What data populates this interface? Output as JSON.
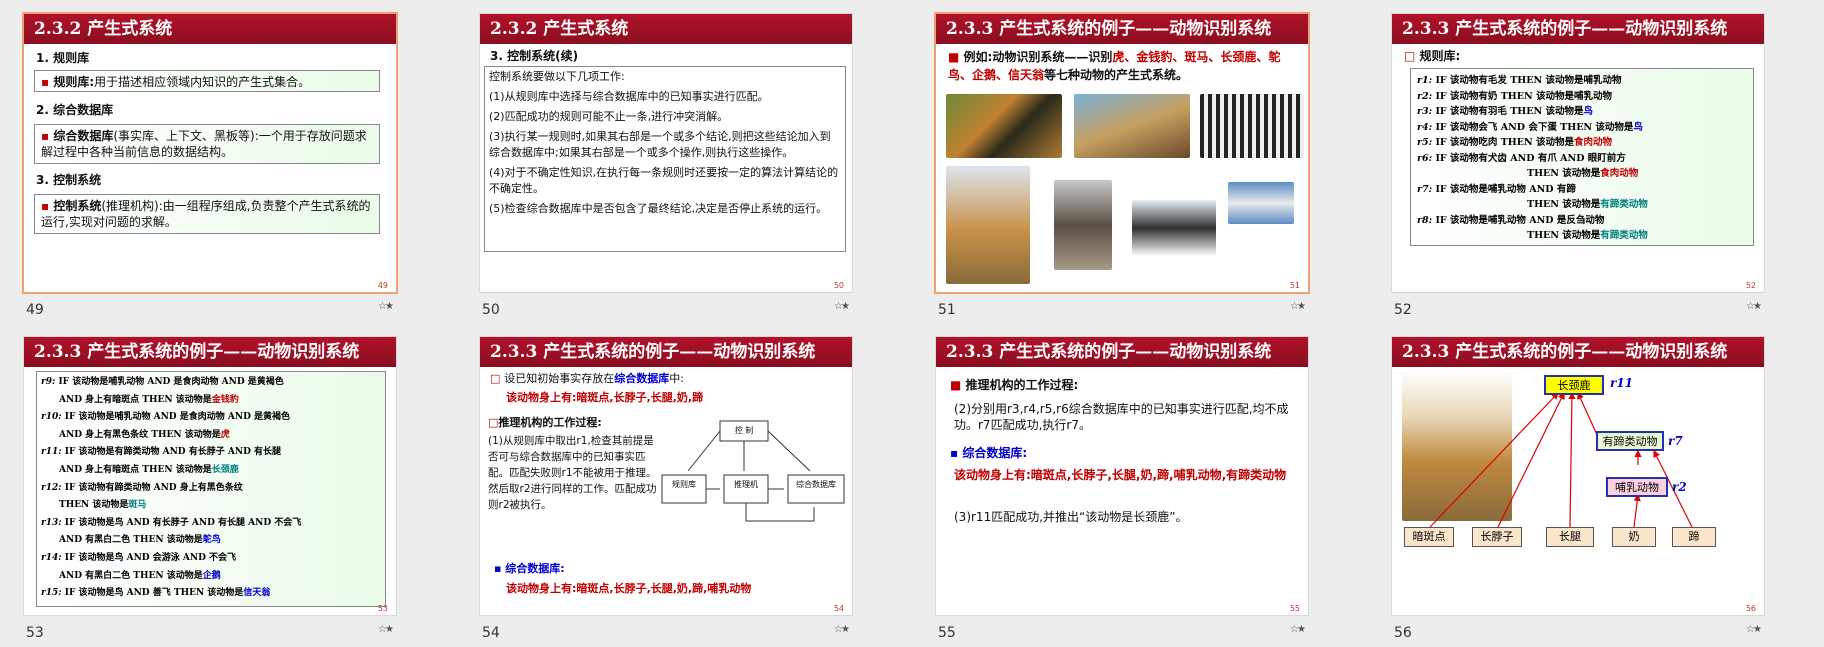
{
  "slides": [
    {
      "label": "49",
      "num": "49",
      "title": "2.3.2  产生式系统",
      "h1": "1. 规则库",
      "b1_key": "规则库:",
      "b1_text": "用于描述相应领域内知识的产生式集合。",
      "h2": "2. 综合数据库",
      "b2_key": "综合数据库",
      "b2_text": "(事实库、上下文、黑板等):一个用于存放问题求解过程中各种当前信息的数据结构。",
      "h3": "3. 控制系统",
      "b3_key": "控制系统",
      "b3_text": "(推理机构):由一组程序组成,负责整个产生式系统的运行,实现对问题的求解。"
    },
    {
      "label": "50",
      "num": "50",
      "title": "2.3.2  产生式系统",
      "h1": "3. 控制系统(续)",
      "lines": [
        "控制系统要做以下几项工作:",
        "(1)从规则库中选择与综合数据库中的已知事实进行匹配。",
        "(2)匹配成功的规则可能不止一条,进行冲突消解。",
        "(3)执行某一规则时,如果其右部是一个或多个结论,则把这些结论加入到综合数据库中;如果其右部是一个或多个操作,则执行这些操作。",
        "(4)对于不确定性知识,在执行每一条规则时还要按一定的算法计算结论的不确定性。",
        "(5)检查综合数据库中是否包含了最终结论,决定是否停止系统的运行。"
      ]
    },
    {
      "label": "51",
      "num": "51",
      "title": "2.3.3  产生式系统的例子——动物识别系统",
      "intro1": "例如:动物识别系统——识别",
      "animals": "虎、金钱豹、斑马、长颈鹿、鸵鸟、企鹅、信天翁",
      "intro2": "等七种动物的产生式系统。"
    },
    {
      "label": "52",
      "num": "52",
      "title": "2.3.3  产生式系统的例子——动物识别系统",
      "h1": "规则库:",
      "rules": [
        {
          "r": "r1:",
          "t": "IF  该动物有毛发    THEN  该动物是哺乳动物",
          "c": ""
        },
        {
          "r": "r2:",
          "t": "IF  该动物有奶      THEN  该动物是哺乳动物",
          "c": ""
        },
        {
          "r": "r3:",
          "t": "IF  该动物有羽毛    THEN  该动物是",
          "c": "鸟"
        },
        {
          "r": "r4:",
          "t": "IF  该动物会飞  AND  会下蛋  THEN  该动物是",
          "c": "鸟"
        },
        {
          "r": "r5:",
          "t": "IF  该动物吃肉    THEN  该动物是",
          "c": "食肉动物"
        },
        {
          "r": "r6:",
          "t": "IF  该动物有犬齿  AND  有爪  AND  眼盯前方",
          "c": ""
        },
        {
          "r": "",
          "t": "               THEN  该动物是",
          "c": "食肉动物"
        },
        {
          "r": "r7:",
          "t": "IF  该动物是哺乳动物  AND  有蹄",
          "c": ""
        },
        {
          "r": "",
          "t": "               THEN  该动物是",
          "c": "有蹄类动物"
        },
        {
          "r": "r8:",
          "t": "IF  该动物是哺乳动物  AND  是反刍动物",
          "c": ""
        },
        {
          "r": "",
          "t": "               THEN  该动物是",
          "c": "有蹄类动物"
        }
      ]
    },
    {
      "label": "53",
      "num": "53",
      "title": "2.3.3  产生式系统的例子——动物识别系统",
      "rules": [
        {
          "r": "r9:",
          "t": "IF  该动物是哺乳动物  AND  是食肉动物 AND  是黄褐色",
          "c": ""
        },
        {
          "r": "",
          "t": "      AND  身上有暗斑点      THEN  该动物是",
          "c": "金钱豹"
        },
        {
          "r": "r10:",
          "t": "IF  该动物是哺乳动物  AND  是食肉动物  AND  是黄褐色",
          "c": ""
        },
        {
          "r": "",
          "t": "      AND  身上有黑色条纹   THEN  该动物是",
          "c": "虎"
        },
        {
          "r": "r11:",
          "t": "IF  该动物是有蹄类动物  AND  有长脖子  AND 有长腿",
          "c": ""
        },
        {
          "r": "",
          "t": "      AND  身上有暗斑点      THEN  该动物是",
          "c": "长颈鹿"
        },
        {
          "r": "r12:",
          "t": "IF  该动物有蹄类动物  AND  身上有黑色条纹",
          "c": ""
        },
        {
          "r": "",
          "t": "                         THEN  该动物是",
          "c": "斑马"
        },
        {
          "r": "r13:",
          "t": "IF  该动物是鸟  AND  有长脖子  AND  有长腿 AND  不会飞",
          "c": ""
        },
        {
          "r": "",
          "t": "      AND  有黑白二色        THEN  该动物是",
          "c": "鸵鸟"
        },
        {
          "r": "r14:",
          "t": "IF  该动物是鸟  AND  会游泳  AND  不会飞",
          "c": ""
        },
        {
          "r": "",
          "t": "      AND  有黑白二色        THEN  该动物是",
          "c": "企鹅"
        },
        {
          "r": "r15:",
          "t": "IF  该动物是鸟  AND  善飞    THEN  该动物是",
          "c": "信天翁"
        }
      ]
    },
    {
      "label": "54",
      "num": "54",
      "title": "2.3.3  产生式系统的例子——动物识别系统",
      "l1a": "设已知初始事实存放在",
      "l1b": "综合数据库",
      "l1c": "中:",
      "facts1": "该动物身上有:暗斑点,长脖子,长腿,奶,蹄",
      "h2": "推理机构的工作过程:",
      "p": "(1)从规则库中取出r1,检查其前提是否可与综合数据库中的已知事实匹配。匹配失败则r1不能被用于推理。然后取r2进行同样的工作。匹配成功则r2被执行。",
      "h3": "综合数据库:",
      "facts2": "该动物身上有:暗斑点,长脖子,长腿,奶,蹄,哺乳动物",
      "diagram": {
        "top": "控 制",
        "left": "规则库",
        "mid": "推理机",
        "right": "综合数据库"
      }
    },
    {
      "label": "55",
      "num": "55",
      "title": "2.3.3  产生式系统的例子——动物识别系统",
      "h1": "推理机构的工作过程:",
      "p2": "(2)分别用r3,r4,r5,r6综合数据库中的已知事实进行匹配,均不成功。r7匹配成功,执行r7。",
      "h2": "综合数据库:",
      "facts": "该动物身上有:暗斑点,长脖子,长腿,奶,蹄,哺乳动物,有蹄类动物",
      "p3": "(3)r11匹配成功,并推出“该动物是长颈鹿”。"
    },
    {
      "label": "56",
      "num": "56",
      "title": "2.3.3  产生式系统的例子——动物识别系统",
      "nodes": {
        "giraffe": "长颈鹿",
        "r11": "r11",
        "ungulate": "有蹄类动物",
        "r7": "r7",
        "mammal": "哺乳动物",
        "r2": "r2",
        "f1": "暗斑点",
        "f2": "长脖子",
        "f3": "长腿",
        "f4": "奶",
        "f5": "蹄"
      }
    }
  ],
  "star": "☆★"
}
